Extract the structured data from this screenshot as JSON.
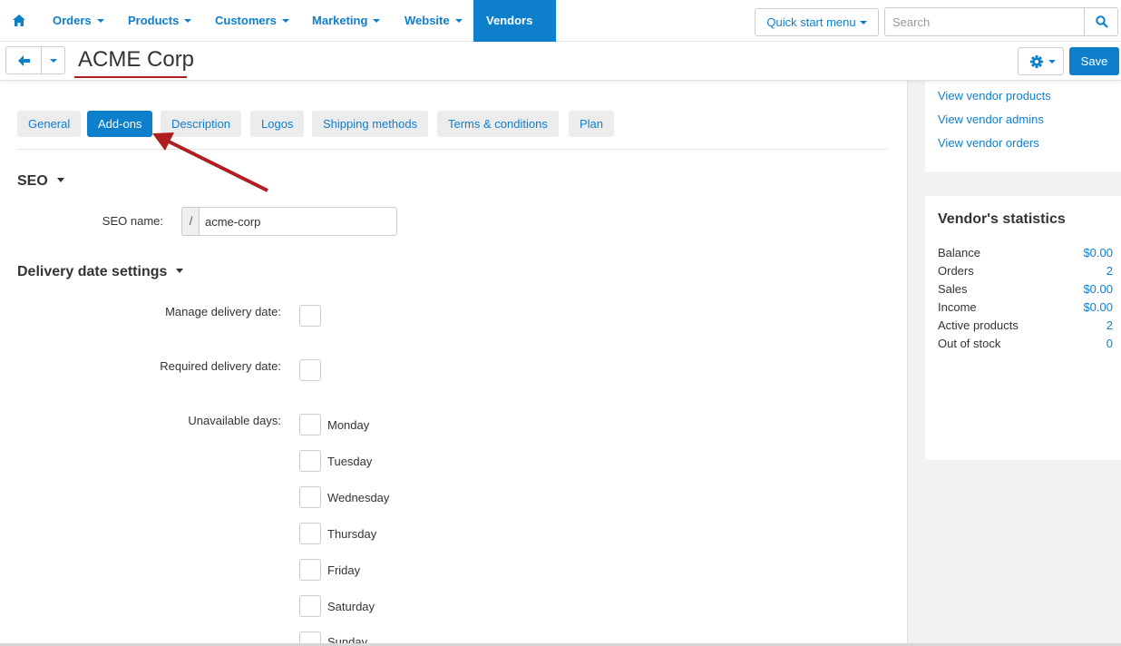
{
  "nav": {
    "items": [
      {
        "label": "Orders"
      },
      {
        "label": "Products"
      },
      {
        "label": "Customers"
      },
      {
        "label": "Marketing"
      },
      {
        "label": "Website"
      },
      {
        "label": "Vendors"
      }
    ],
    "active": "Vendors",
    "quick_start": "Quick start menu",
    "search_placeholder": "Search"
  },
  "header": {
    "title": "ACME Corp",
    "save_label": "Save"
  },
  "tabs": [
    {
      "label": "General"
    },
    {
      "label": "Add-ons"
    },
    {
      "label": "Description"
    },
    {
      "label": "Logos"
    },
    {
      "label": "Shipping methods"
    },
    {
      "label": "Terms & conditions"
    },
    {
      "label": "Plan"
    }
  ],
  "active_tab": "Add-ons",
  "seo": {
    "title": "SEO",
    "name_label": "SEO name:",
    "prefix": "/",
    "name_value": "acme-corp"
  },
  "delivery": {
    "title": "Delivery date settings",
    "manage_label": "Manage delivery date:",
    "required_label": "Required delivery date:",
    "unavailable_label": "Unavailable days:",
    "days": [
      "Monday",
      "Tuesday",
      "Wednesday",
      "Thursday",
      "Friday",
      "Saturday",
      "Sunday"
    ]
  },
  "sidebar": {
    "links": [
      "View vendor products",
      "View vendor admins",
      "View vendor orders"
    ],
    "stats_title": "Vendor's statistics",
    "stats": [
      {
        "label": "Balance",
        "value": "$0.00"
      },
      {
        "label": "Orders",
        "value": "2"
      },
      {
        "label": "Sales",
        "value": "$0.00"
      },
      {
        "label": "Income",
        "value": "$0.00"
      },
      {
        "label": "Active products",
        "value": "2"
      },
      {
        "label": "Out of stock",
        "value": "0"
      }
    ]
  },
  "colors": {
    "accent": "#0e7fcb",
    "arrow": "#b01f1f"
  }
}
